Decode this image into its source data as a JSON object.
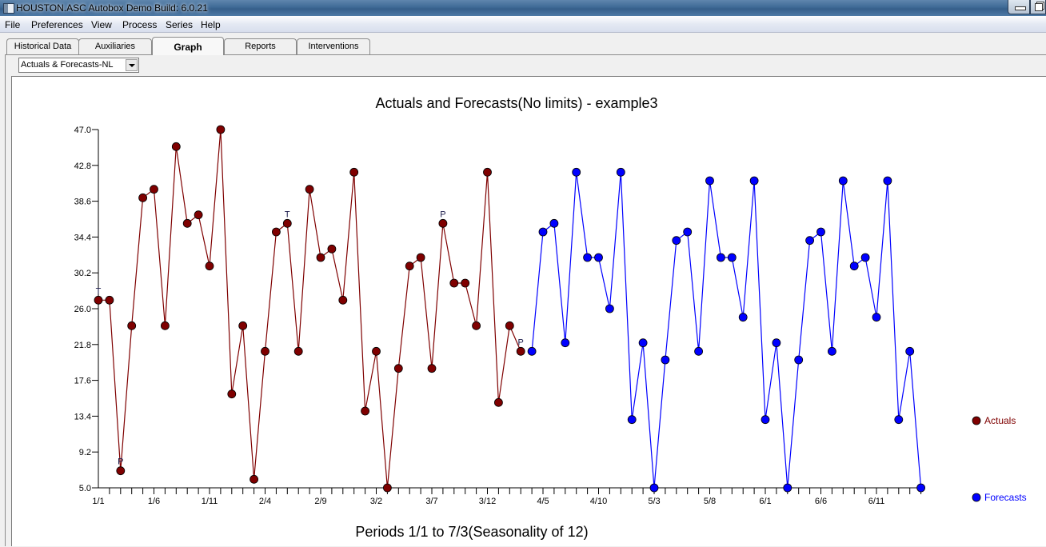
{
  "window": {
    "title": "HOUSTON.ASC  Autobox Demo Build: 6.0.21"
  },
  "menu": [
    "File",
    "Preferences",
    "View",
    "Process",
    "Series",
    "Help"
  ],
  "tabs": [
    {
      "label": "Historical Data",
      "active": false
    },
    {
      "label": "Auxiliaries",
      "active": false
    },
    {
      "label": "Graph",
      "active": true
    },
    {
      "label": "Reports",
      "active": false
    },
    {
      "label": "Interventions",
      "active": false
    }
  ],
  "graph_type_select": {
    "value": "Actuals & Forecasts-NL"
  },
  "colors": {
    "actuals": "#7f0000",
    "forecasts": "#0000ff"
  },
  "chart_data": {
    "type": "line",
    "title": "Actuals and Forecasts(No limits) - example3",
    "xlabel": "Periods 1/1 to 7/3(Seasonality of 12)",
    "ylabel": "",
    "ylim": [
      5.0,
      47.0
    ],
    "y_ticks": [
      "47.0",
      "42.8",
      "38.6",
      "34.4",
      "30.2",
      "26.0",
      "21.8",
      "17.6",
      "13.4",
      "9.2",
      "5.0"
    ],
    "x_tick_count": 75,
    "x_tick_labels": [
      {
        "index": 0,
        "label": "1/1"
      },
      {
        "index": 5,
        "label": "1/6"
      },
      {
        "index": 10,
        "label": "1/11"
      },
      {
        "index": 15,
        "label": "2/4"
      },
      {
        "index": 20,
        "label": "2/9"
      },
      {
        "index": 25,
        "label": "3/2"
      },
      {
        "index": 30,
        "label": "3/7"
      },
      {
        "index": 35,
        "label": "3/12"
      },
      {
        "index": 40,
        "label": "4/5"
      },
      {
        "index": 45,
        "label": "4/10"
      },
      {
        "index": 50,
        "label": "5/3"
      },
      {
        "index": 55,
        "label": "5/8"
      },
      {
        "index": 60,
        "label": "6/1"
      },
      {
        "index": 65,
        "label": "6/6"
      },
      {
        "index": 70,
        "label": "6/11"
      }
    ],
    "grid": false,
    "legend_position": "right",
    "series": [
      {
        "name": "Actuals",
        "start_index": 0,
        "values": [
          27,
          27,
          7,
          24,
          39,
          40,
          24,
          45,
          36,
          37,
          31,
          47,
          16,
          24,
          6,
          21,
          35,
          36,
          21,
          40,
          32,
          33,
          27,
          42,
          14,
          21,
          5,
          19,
          31,
          32,
          19,
          36,
          29,
          29,
          24,
          42,
          15,
          24,
          21
        ]
      },
      {
        "name": "Forecasts",
        "start_index": 39,
        "values": [
          21,
          35,
          36,
          22,
          42,
          32,
          32,
          26,
          42,
          13,
          22,
          5,
          20,
          34,
          35,
          21,
          41,
          32,
          32,
          25,
          41,
          13,
          22,
          5,
          20,
          34,
          35,
          21,
          41,
          31,
          32,
          25,
          41,
          13,
          21,
          5
        ]
      }
    ],
    "annotations": [
      {
        "index": 0,
        "label": "T"
      },
      {
        "index": 2,
        "label": "P"
      },
      {
        "index": 17,
        "label": "T"
      },
      {
        "index": 31,
        "label": "P"
      },
      {
        "index": 38,
        "label": "P"
      }
    ]
  }
}
